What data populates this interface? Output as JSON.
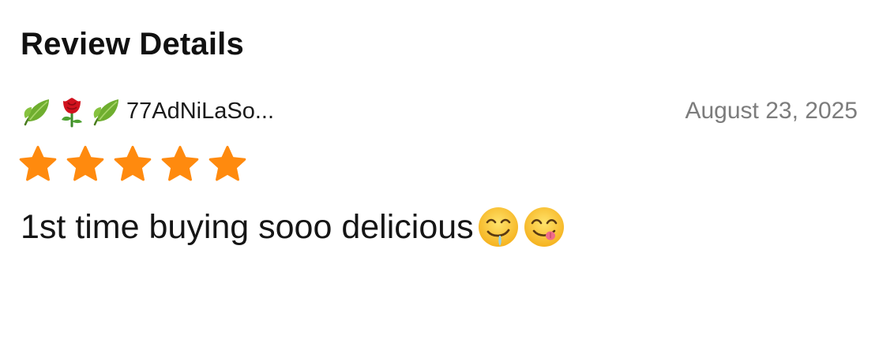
{
  "header": {
    "title": "Review Details"
  },
  "review": {
    "reviewer": {
      "emoji_icons": [
        "leaf-icon",
        "rose-icon",
        "leaf-icon"
      ],
      "name": "77AdNiLaSo..."
    },
    "date": "August 23, 2025",
    "rating": {
      "value": 5,
      "max": 5,
      "star_color": "#FF8A0E"
    },
    "text": "1st time buying sooo delicious",
    "text_emoji_icons": [
      "drooling-face-icon",
      "face-savoring-food-icon"
    ]
  }
}
